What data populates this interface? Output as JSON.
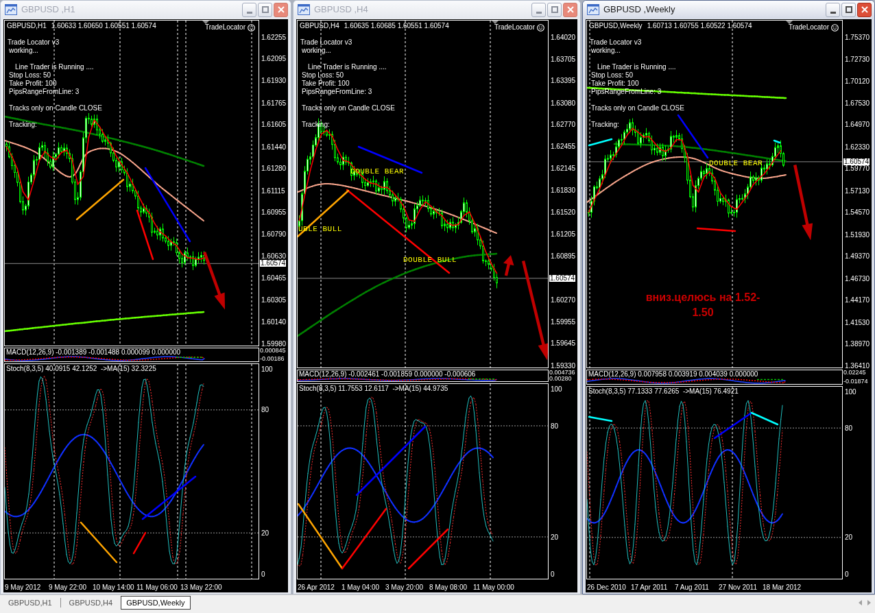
{
  "windows": [
    {
      "title": "GBPUSD ,H1",
      "active": false,
      "chart": {
        "symbol": "GBPUSD,H1",
        "ohlc": "1.60633 1.60650 1.60551 1.60574",
        "indicator": "TradeLocator",
        "info_blocks": [
          [
            {
              "kind": "title",
              "text": "Trade Locator v3"
            },
            {
              "kind": "line",
              "text": "working..."
            }
          ],
          [
            {
              "kind": "status",
              "text": "Line Trader is Running ...."
            },
            {
              "kind": "line",
              "text": "Stop Loss: 50"
            },
            {
              "kind": "line",
              "text": "Take Profit: 100"
            },
            {
              "kind": "line",
              "text": "PipsRangeFromLine: 3"
            }
          ],
          [
            {
              "kind": "line",
              "text": "Tracks only on Candle CLOSE"
            }
          ],
          [
            {
              "kind": "line",
              "text": "Tracking:"
            }
          ]
        ],
        "price_axis": [
          "1.62255",
          "1.62095",
          "1.61930",
          "1.61765",
          "1.61605",
          "1.61440",
          "1.61280",
          "1.61115",
          "1.60955",
          "1.60790",
          "1.60630",
          "1.60465",
          "1.60305",
          "1.60140",
          "1.59980"
        ],
        "current_price": "1.60574"
      },
      "macd": {
        "label": "MACD(12,26,9) -0.001389 -0.001488 0.000099 0.000000",
        "axis": [
          "0.000845",
          "-0.00186"
        ]
      },
      "stoch": {
        "label": "Stoch(8,3,5) 40.0915 42.1252  ->MA(15) 32.3225",
        "axis": [
          "100",
          "80",
          "20",
          "0"
        ]
      },
      "time_axis": [
        "9 May 2012",
        "9 May 22:00",
        "10 May 14:00",
        "11 May 06:00",
        "13 May 22:00"
      ]
    },
    {
      "title": "GBPUSD ,H4",
      "active": false,
      "chart": {
        "symbol": "GBPUSD,H4",
        "ohlc": "1.60635 1.60685 1.60551 1.60574",
        "indicator": "TradeLocator",
        "info_blocks": [
          [
            {
              "kind": "title",
              "text": "Trade Locator v3"
            },
            {
              "kind": "line",
              "text": "working..."
            }
          ],
          [
            {
              "kind": "status",
              "text": "Line Trader is Running ...."
            },
            {
              "kind": "line",
              "text": "Stop Loss: 50"
            },
            {
              "kind": "line",
              "text": "Take Profit: 100"
            },
            {
              "kind": "line",
              "text": "PipsRangeFromLine: 3"
            }
          ],
          [
            {
              "kind": "line",
              "text": "Tracks only on Candle CLOSE"
            }
          ],
          [
            {
              "kind": "line",
              "text": "Tracking:"
            }
          ]
        ],
        "labels": [
          {
            "kind": "pattern",
            "lines": [
              "DOUBLE BEAR"
            ]
          },
          {
            "kind": "pattern",
            "lines": [
              "UBLE BULL"
            ]
          },
          {
            "kind": "pattern",
            "lines": [
              "DOUBLE BULL"
            ]
          }
        ],
        "price_axis": [
          "1.64020",
          "1.63705",
          "1.63395",
          "1.63080",
          "1.62770",
          "1.62455",
          "1.62145",
          "1.61830",
          "1.61520",
          "1.61205",
          "1.60895",
          "1.60270",
          "1.59955",
          "1.59645",
          "1.59330"
        ],
        "current_price": "1.60574"
      },
      "macd": {
        "label": "MACD(12,26,9) -0.002461 -0.001859 0.000000 -0.000606",
        "axis": [
          "0.004736",
          "0.00280"
        ]
      },
      "stoch": {
        "label": "Stoch(8,3,5) 11.7553 12.6117  ->MA(15) 44.9735",
        "axis": [
          "100",
          "80",
          "20",
          "0"
        ]
      },
      "time_axis": [
        "26 Apr 2012",
        "1 May 04:00",
        "3 May 20:00",
        "8 May 08:00",
        "11 May 00:00"
      ]
    },
    {
      "title": "GBPUSD ,Weekly",
      "active": true,
      "chart": {
        "symbol": "GBPUSD,Weekly",
        "ohlc": "1.60713 1.60755 1.60522 1.60574",
        "indicator": "TradeLocator",
        "info_blocks": [
          [
            {
              "kind": "title",
              "text": "Trade Locator v3"
            },
            {
              "kind": "line",
              "text": "working..."
            }
          ],
          [
            {
              "kind": "status",
              "text": "Line Trader is Running ...."
            },
            {
              "kind": "line",
              "text": "Stop Loss: 50"
            },
            {
              "kind": "line",
              "text": "Take Profit: 100"
            },
            {
              "kind": "line",
              "text": "PipsRangeFromLine: 3"
            }
          ],
          [
            {
              "kind": "line",
              "text": "Tracks only on Candle CLOSE"
            }
          ],
          [
            {
              "kind": "line",
              "text": "Tracking:"
            }
          ]
        ],
        "labels": [
          {
            "kind": "pattern",
            "lines": [
              "DOUBLE BEAR"
            ]
          },
          {
            "kind": "note",
            "lines": [
              "вниз.целюсь на 1.52-",
              "1.50"
            ]
          }
        ],
        "price_axis": [
          "1.75370",
          "1.72730",
          "1.70120",
          "1.67530",
          "1.64970",
          "1.62330",
          "1.59770",
          "1.57130",
          "1.54570",
          "1.51930",
          "1.49370",
          "1.46730",
          "1.44170",
          "1.41530",
          "1.38970",
          "1.36410"
        ],
        "current_price": "1.60574"
      },
      "macd": {
        "label": "MACD(12,26,9) 0.007958 0.003919 0.004039 0.000000",
        "axis": [
          "0.02245",
          "-0.01874"
        ]
      },
      "stoch": {
        "label": "Stoch(8,3,5) 77.1333 77.6265  ->MA(15) 76.4921",
        "axis": [
          "100",
          "80",
          "20",
          "0"
        ]
      },
      "time_axis": [
        "26 Dec 2010",
        "17 Apr 2011",
        "7 Aug 2011",
        "27 Nov 2011",
        "18 Mar 2012"
      ]
    }
  ],
  "tabs": [
    {
      "label": "GBPUSD,H1",
      "selected": false
    },
    {
      "label": "GBPUSD,H4",
      "selected": false
    },
    {
      "label": "GBPUSD,Weekly",
      "selected": true
    }
  ]
}
